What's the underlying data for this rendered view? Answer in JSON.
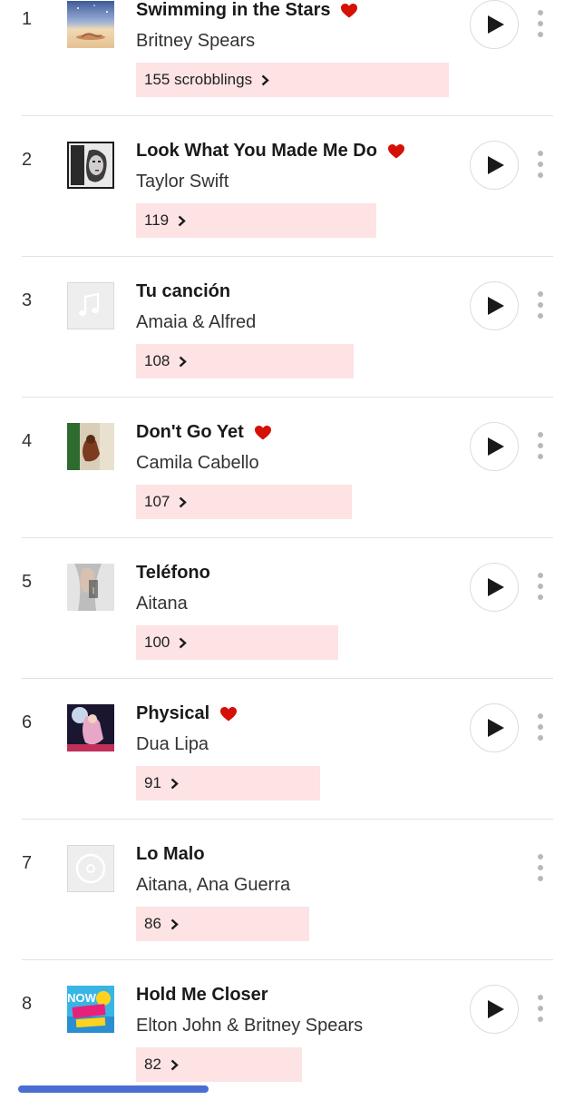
{
  "tracks": [
    {
      "rank": "1",
      "title": "Swimming in the Stars",
      "artist": "Britney Spears",
      "loved": true,
      "scrobbles_label": "155 scrobblings",
      "scrobbles": 155,
      "has_play": true,
      "cover_icon": "album-art-swimming-in-the-stars"
    },
    {
      "rank": "2",
      "title": "Look What You Made Me Do",
      "artist": "Taylor Swift",
      "loved": true,
      "scrobbles_label": "119",
      "scrobbles": 119,
      "has_play": true,
      "cover_icon": "album-art-look-what-you-made-me-do"
    },
    {
      "rank": "3",
      "title": "Tu canción",
      "artist": "Amaia & Alfred",
      "loved": false,
      "scrobbles_label": "108",
      "scrobbles": 108,
      "has_play": true,
      "cover_icon": "music-note-placeholder-icon"
    },
    {
      "rank": "4",
      "title": "Don't Go Yet",
      "artist": "Camila Cabello",
      "loved": true,
      "scrobbles_label": "107",
      "scrobbles": 107,
      "has_play": true,
      "cover_icon": "album-art-dont-go-yet"
    },
    {
      "rank": "5",
      "title": "Teléfono",
      "artist": "Aitana",
      "loved": false,
      "scrobbles_label": "100",
      "scrobbles": 100,
      "has_play": true,
      "cover_icon": "album-art-telefono"
    },
    {
      "rank": "6",
      "title": "Physical",
      "artist": "Dua Lipa",
      "loved": true,
      "scrobbles_label": "91",
      "scrobbles": 91,
      "has_play": true,
      "cover_icon": "album-art-physical"
    },
    {
      "rank": "7",
      "title": "Lo Malo",
      "artist": "Aitana, Ana Guerra",
      "loved": false,
      "scrobbles_label": "86",
      "scrobbles": 86,
      "has_play": false,
      "cover_icon": "disc-placeholder-icon"
    },
    {
      "rank": "8",
      "title": "Hold Me Closer",
      "artist": "Elton John & Britney Spears",
      "loved": false,
      "scrobbles_label": "82",
      "scrobbles": 82,
      "has_play": true,
      "cover_icon": "album-art-now-summer-party"
    }
  ],
  "colors": {
    "heart": "#d51007",
    "bar_fill": "#fde3e4",
    "play_icon": "#1a1a1a",
    "divider": "#e2e2e2"
  },
  "icons": {
    "loved": "heart-icon",
    "bar_link": "chevron-right-icon",
    "play": "play-icon",
    "more": "more-vertical-icon"
  }
}
